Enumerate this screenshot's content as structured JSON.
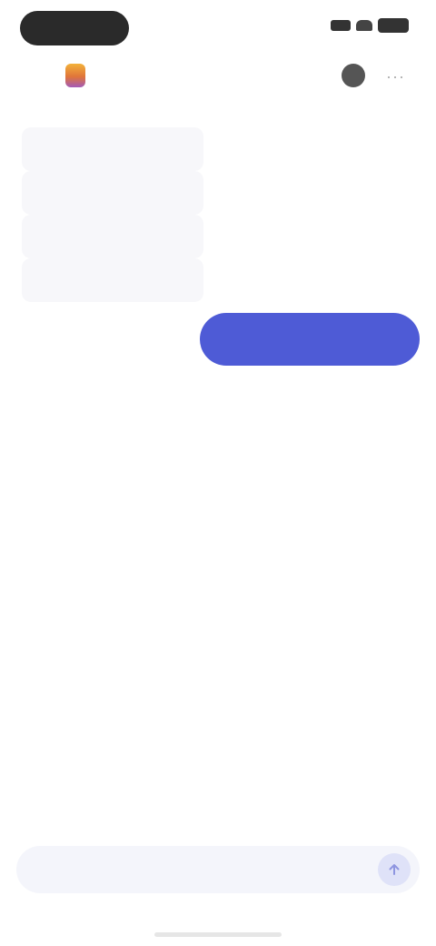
{
  "status_bar": {
    "time": "",
    "icons": [
      "cellular-signal-icon",
      "wifi-icon",
      "battery-icon"
    ]
  },
  "header": {
    "app_name": "",
    "logo_icon": "app-logo-icon",
    "avatar_icon": "profile-avatar-icon",
    "more_icon": "more-options-icon"
  },
  "suggestions": [
    {
      "label": ""
    },
    {
      "label": ""
    },
    {
      "label": ""
    },
    {
      "label": ""
    }
  ],
  "suggestion_hint": "",
  "conversation": {
    "user_message": "",
    "assistant_title": "",
    "assistant_body": "",
    "assistant_aside": ""
  },
  "quick_actions": [
    {
      "label": ""
    },
    {
      "label": ""
    }
  ],
  "composer": {
    "placeholder": "",
    "send_icon": "send-arrow-icon"
  },
  "colors": {
    "accent": "#4e5bd6",
    "composer_bg": "#f4f5fb",
    "send_bg": "#dfe2f8"
  }
}
